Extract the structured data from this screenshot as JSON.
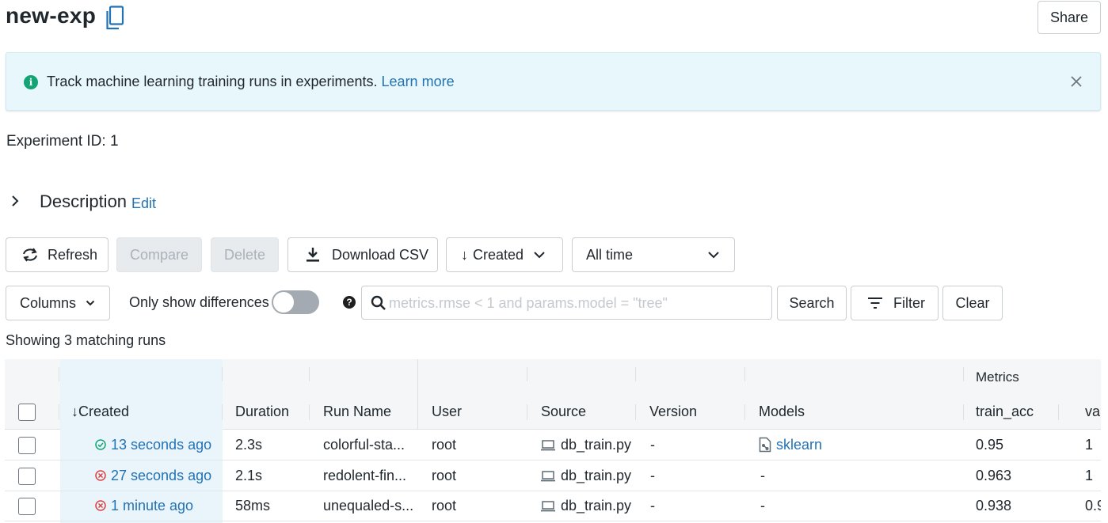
{
  "header": {
    "title": "new-exp",
    "share_label": "Share"
  },
  "banner": {
    "text": "Track machine learning training runs in experiments.",
    "link": "Learn more"
  },
  "experiment": {
    "id_label": "Experiment ID:",
    "id_value": "1"
  },
  "description": {
    "label": "Description",
    "edit": "Edit"
  },
  "toolbar": {
    "refresh": "Refresh",
    "compare": "Compare",
    "delete": "Delete",
    "download_csv": "Download CSV",
    "sort_label": "Created",
    "time_range": "All time",
    "columns": "Columns",
    "only_diff": "Only show differences",
    "search_placeholder": "metrics.rmse < 1 and params.model = \"tree\"",
    "search": "Search",
    "filter": "Filter",
    "clear": "Clear"
  },
  "summary": "Showing 3 matching runs",
  "table": {
    "group_header": "Metrics",
    "columns": {
      "created": "Created",
      "duration": "Duration",
      "run_name": "Run Name",
      "user": "User",
      "source": "Source",
      "version": "Version",
      "models": "Models",
      "train_acc": "train_acc",
      "val": "val"
    },
    "rows": [
      {
        "status": "success",
        "created": "13 seconds ago",
        "duration": "2.3s",
        "run_name": "colorful-sta...",
        "user": "root",
        "source": "db_train.py",
        "version": "-",
        "models": "sklearn",
        "train_acc": "0.95",
        "val": "1"
      },
      {
        "status": "failed",
        "created": "27 seconds ago",
        "duration": "2.1s",
        "run_name": "redolent-fin...",
        "user": "root",
        "source": "db_train.py",
        "version": "-",
        "models": "-",
        "train_acc": "0.963",
        "val": "1"
      },
      {
        "status": "failed",
        "created": "1 minute ago",
        "duration": "58ms",
        "run_name": "unequaled-s...",
        "user": "root",
        "source": "db_train.py",
        "version": "-",
        "models": "-",
        "train_acc": "0.938",
        "val": "0.9"
      }
    ]
  },
  "colors": {
    "link": "#2272b4",
    "success": "#13a374",
    "failed": "#d64141",
    "banner_bg": "#e8f7fc"
  }
}
